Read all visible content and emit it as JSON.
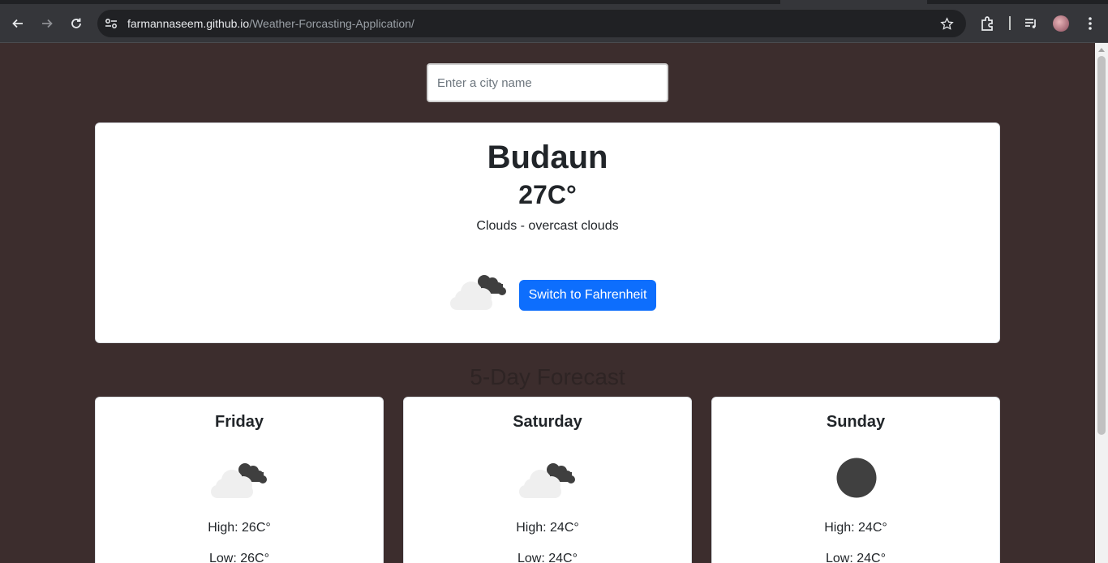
{
  "browser": {
    "url_host": "farmannaseem.github.io",
    "url_path": "/Weather-Forcasting-Application/"
  },
  "search": {
    "placeholder": "Enter a city name",
    "value": ""
  },
  "current": {
    "city": "Budaun",
    "temperature": "27C°",
    "description": "Clouds - overcast clouds",
    "icon": "overcast-clouds-icon",
    "switch_label": "Switch to Fahrenheit"
  },
  "forecast": {
    "title": "5-Day Forecast",
    "days": [
      {
        "name": "Friday",
        "icon": "overcast-clouds-icon",
        "high": "High: 26C°",
        "low": "Low: 26C°"
      },
      {
        "name": "Saturday",
        "icon": "overcast-clouds-icon",
        "high": "High: 24C°",
        "low": "Low: 24C°"
      },
      {
        "name": "Sunday",
        "icon": "dark-circle-icon",
        "high": "High: 24C°",
        "low": "Low: 24C°"
      }
    ]
  },
  "colors": {
    "page_background": "#3c2d2d",
    "button_primary": "#0d6efd",
    "card_background": "#ffffff"
  }
}
